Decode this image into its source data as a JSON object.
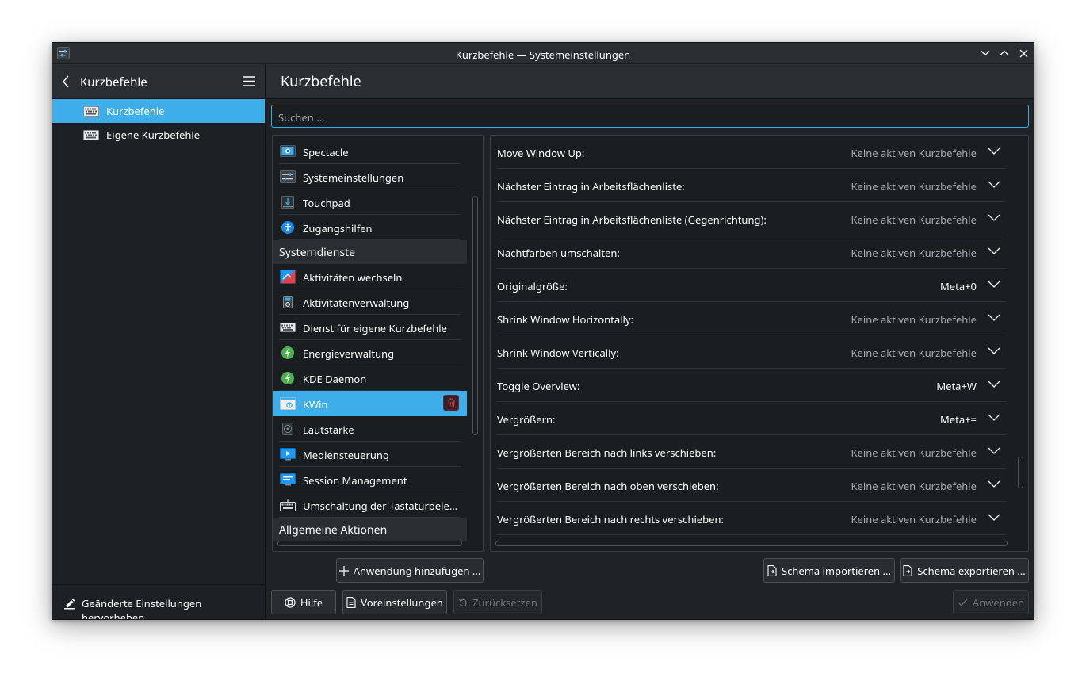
{
  "window": {
    "title": "Kurzbefehle — Systemeinstellungen"
  },
  "sidebar": {
    "title": "Kurzbefehle",
    "items": [
      {
        "label": "Kurzbefehle",
        "active": true
      },
      {
        "label": "Eigene Kurzbefehle",
        "active": false
      }
    ],
    "footer_label": "Geänderte Einstellungen hervorheben"
  },
  "main": {
    "title": "Kurzbefehle",
    "search_placeholder": "Suchen ..."
  },
  "components": [
    {
      "type": "item",
      "label": "Spectacle",
      "icon": "spectacle-icon"
    },
    {
      "type": "item",
      "label": "Systemeinstellungen",
      "icon": "systemsettings-icon"
    },
    {
      "type": "item",
      "label": "Touchpad",
      "icon": "touchpad-icon"
    },
    {
      "type": "item",
      "label": "Zugangshilfen",
      "icon": "accessibility-icon"
    },
    {
      "type": "group",
      "label": "Systemdienste"
    },
    {
      "type": "item",
      "label": "Aktivitäten wechseln",
      "icon": "activities-icon"
    },
    {
      "type": "item",
      "label": "Aktivitätenverwaltung",
      "icon": "activity-manager-icon"
    },
    {
      "type": "item",
      "label": "Dienst für eigene Kurzbefehle",
      "icon": "keyboard-icon"
    },
    {
      "type": "item",
      "label": "Energieverwaltung",
      "icon": "power-icon"
    },
    {
      "type": "item",
      "label": "KDE Daemon",
      "icon": "kded-icon"
    },
    {
      "type": "item",
      "label": "KWin",
      "icon": "kwin-icon",
      "active": true
    },
    {
      "type": "item",
      "label": "Lautstärke",
      "icon": "volume-icon"
    },
    {
      "type": "item",
      "label": "Mediensteuerung",
      "icon": "media-icon"
    },
    {
      "type": "item",
      "label": "Session Management",
      "icon": "session-icon"
    },
    {
      "type": "item",
      "label": "Umschaltung der Tastaturbele…",
      "icon": "keyboard-layout-icon"
    },
    {
      "type": "group",
      "label": "Allgemeine Aktionen"
    }
  ],
  "shortcuts": [
    {
      "name": "Move Window Up:",
      "value": "Keine aktiven Kurzbefehle",
      "active": false
    },
    {
      "name": "Nächster Eintrag in Arbeitsflächenliste:",
      "value": "Keine aktiven Kurzbefehle",
      "active": false
    },
    {
      "name": "Nächster Eintrag in Arbeitsflächenliste (Gegenrichtung):",
      "value": "Keine aktiven Kurzbefehle",
      "active": false
    },
    {
      "name": "Nachtfarben umschalten:",
      "value": "Keine aktiven Kurzbefehle",
      "active": false
    },
    {
      "name": "Originalgröße:",
      "value": "Meta+0",
      "active": true
    },
    {
      "name": "Shrink Window Horizontally:",
      "value": "Keine aktiven Kurzbefehle",
      "active": false
    },
    {
      "name": "Shrink Window Vertically:",
      "value": "Keine aktiven Kurzbefehle",
      "active": false
    },
    {
      "name": "Toggle Overview:",
      "value": "Meta+W",
      "active": true
    },
    {
      "name": "Vergrößern:",
      "value": "Meta+=",
      "active": true
    },
    {
      "name": "Vergrößerten Bereich nach links verschieben:",
      "value": "Keine aktiven Kurzbefehle",
      "active": false
    },
    {
      "name": "Vergrößerten Bereich nach oben verschieben:",
      "value": "Keine aktiven Kurzbefehle",
      "active": false
    },
    {
      "name": "Vergrößerten Bereich nach rechts verschieben:",
      "value": "Keine aktiven Kurzbefehle",
      "active": false
    }
  ],
  "buttons": {
    "add_app": "Anwendung hinzufügen ...",
    "import_scheme": "Schema importieren ...",
    "export_scheme": "Schema exportieren ...",
    "help": "Hilfe",
    "defaults": "Voreinstellungen",
    "reset": "Zurücksetzen",
    "apply": "Anwenden"
  },
  "colors": {
    "accent": "#3daee9",
    "window_bg": "#1b1e20",
    "header_bg": "#2a2e32",
    "dim_text": "#a1a9b1",
    "danger": "#da4453"
  }
}
